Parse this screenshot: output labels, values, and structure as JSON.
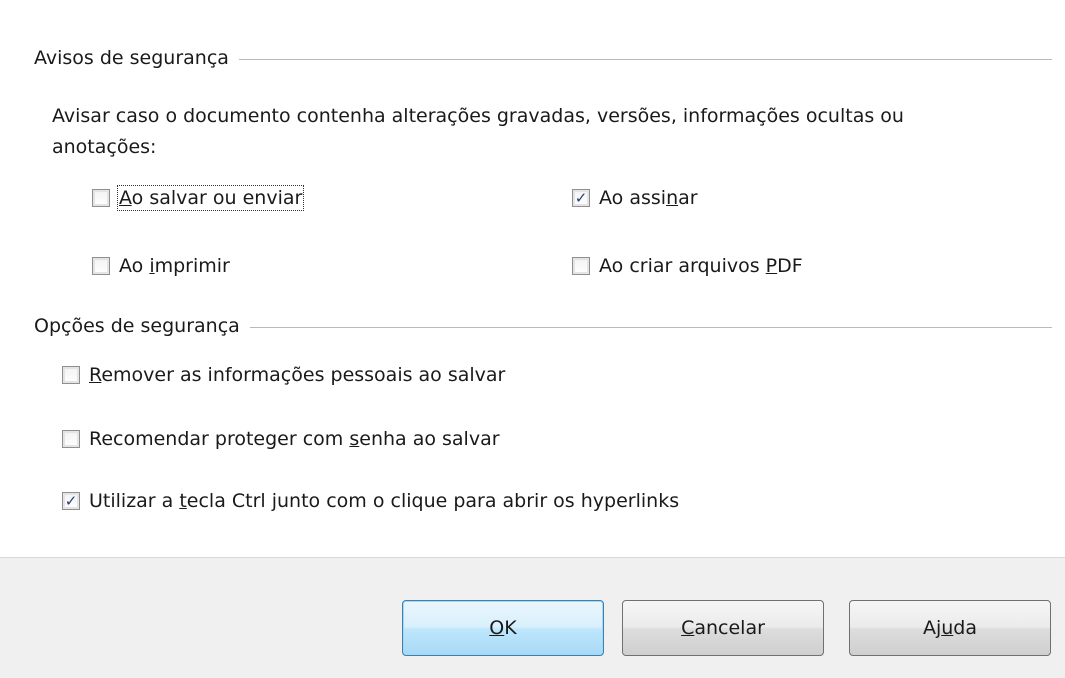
{
  "sections": {
    "warnings": {
      "title": "Avisos de segurança",
      "description_line1": "Avisar caso o documento contenha alterações gravadas, versões, informações ocultas ou",
      "description_line2": "anotações:",
      "options": [
        {
          "pre": "",
          "accel": "A",
          "post": "o salvar ou enviar",
          "checked": false,
          "focused": true
        },
        {
          "pre": "Ao assi",
          "accel": "n",
          "post": "ar",
          "checked": true,
          "focused": false
        },
        {
          "pre": "Ao ",
          "accel": "i",
          "post": "mprimir",
          "checked": false,
          "focused": false
        },
        {
          "pre": "Ao criar arquivos ",
          "accel": "P",
          "post": "DF",
          "checked": false,
          "focused": false
        }
      ]
    },
    "security_options": {
      "title": "Opções de segurança",
      "options": [
        {
          "pre": "",
          "accel": "R",
          "post": "emover as informações pessoais ao salvar",
          "checked": false
        },
        {
          "pre": "Recomendar proteger com ",
          "accel": "s",
          "post": "enha ao salvar",
          "checked": false
        },
        {
          "pre": "Utilizar a ",
          "accel": "t",
          "post": "ecla Ctrl junto com o clique para abrir os hyperlinks",
          "checked": true
        }
      ]
    }
  },
  "buttons": {
    "ok": {
      "pre": "",
      "accel": "O",
      "post": "K"
    },
    "cancel": {
      "pre": "",
      "accel": "C",
      "post": "ancelar"
    },
    "help": {
      "pre": "Aj",
      "accel": "u",
      "post": "da"
    }
  },
  "check_glyph": "✓"
}
